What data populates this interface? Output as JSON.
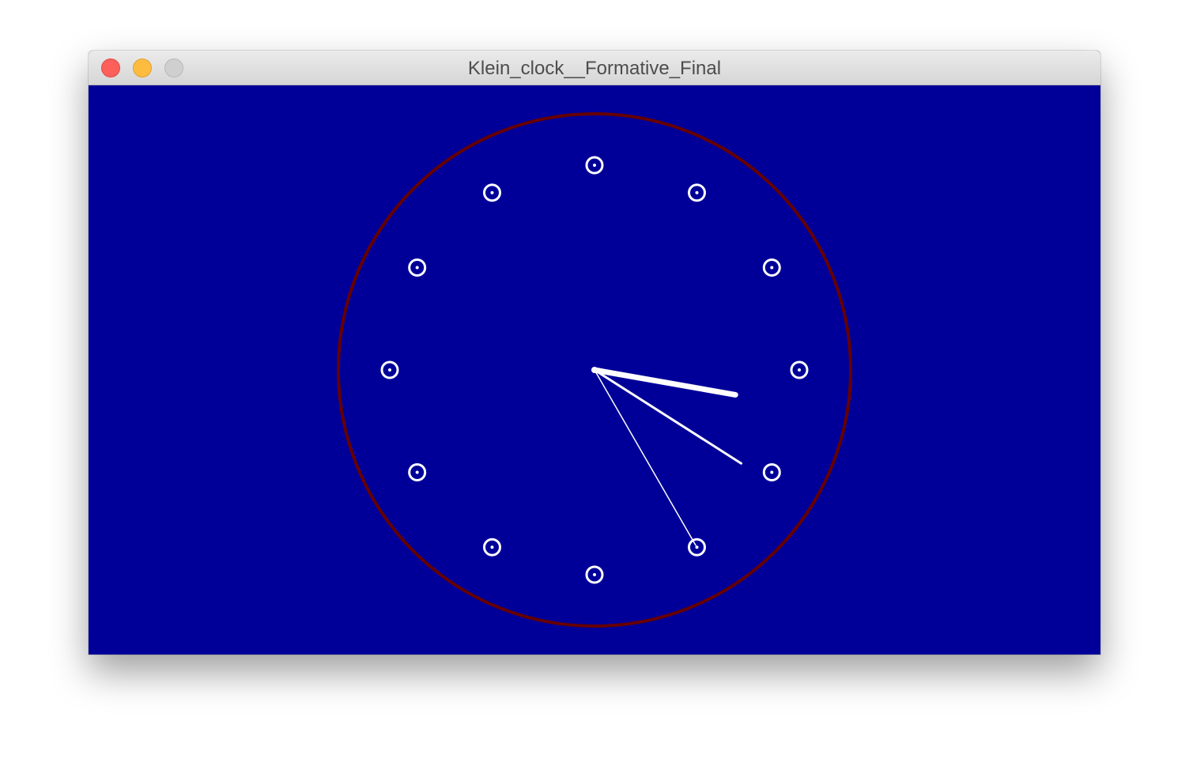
{
  "window": {
    "title": "Klein_clock__Formative_Final",
    "controls": {
      "close": "close-button",
      "minimize": "minimize-button",
      "zoom": "zoom-button"
    }
  },
  "clock": {
    "time": {
      "hour": 3,
      "minute": 20,
      "second": 25
    },
    "hour_markers": 12,
    "colors": {
      "background": "#000099",
      "rim": "#660000",
      "hands": "#ffffff",
      "markers": "#ffffff"
    }
  }
}
